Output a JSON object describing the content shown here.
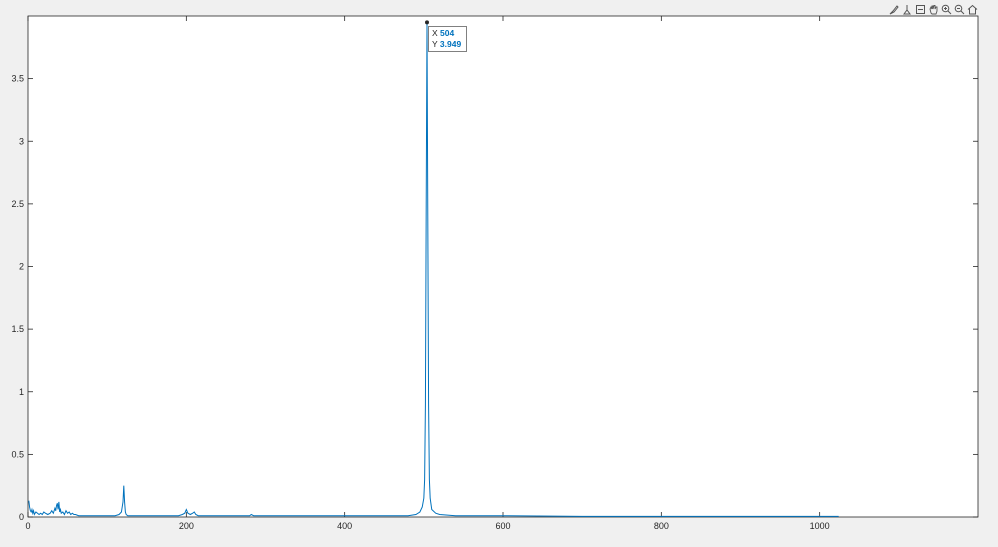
{
  "toolbar": {
    "icons": [
      "brush-icon",
      "datatip-icon",
      "rotate-icon",
      "pan-icon",
      "zoom-in-icon",
      "zoom-out-icon",
      "home-icon"
    ]
  },
  "datatip": {
    "x_label": "X",
    "x_value": "504",
    "y_label": "Y",
    "y_value": "3.949"
  },
  "colors": {
    "line": "#0072bd",
    "axes_bg": "#ffffff",
    "figure_bg": "#f0f0f0",
    "axis": "#262626"
  },
  "chart_data": {
    "type": "line",
    "title": "",
    "xlabel": "",
    "ylabel": "",
    "xlim": [
      0,
      1200
    ],
    "ylim": [
      0,
      4
    ],
    "xticks": [
      0,
      200,
      400,
      600,
      800,
      1000
    ],
    "xtick_labels": [
      "0",
      "200",
      "400",
      "600",
      "800",
      "1000"
    ],
    "yticks": [
      0,
      0.5,
      1,
      1.5,
      2,
      2.5,
      3,
      3.5
    ],
    "ytick_labels": [
      "0",
      "0.5",
      "1",
      "1.5",
      "2",
      "2.5",
      "3",
      "3.5"
    ],
    "grid": false,
    "series": [
      {
        "x": [
          1,
          2,
          3,
          4,
          5,
          6,
          7,
          8,
          10,
          12,
          14,
          16,
          18,
          20,
          22,
          25,
          28,
          30,
          32,
          34,
          35,
          36,
          37,
          38,
          39,
          40,
          41,
          42,
          44,
          46,
          48,
          50,
          52,
          54,
          56,
          58,
          60,
          64,
          70,
          80,
          90,
          100,
          110,
          115,
          118,
          120,
          121,
          122,
          123,
          124,
          126,
          130,
          140,
          150,
          160,
          170,
          180,
          190,
          195,
          198,
          200,
          202,
          205,
          208,
          210,
          212,
          215,
          220,
          240,
          260,
          280,
          282,
          285,
          300,
          350,
          400,
          450,
          480,
          490,
          495,
          498,
          500,
          501,
          502,
          503,
          504,
          505,
          506,
          507,
          508,
          510,
          515,
          520,
          540,
          600,
          700,
          800,
          900,
          1000,
          1024
        ],
        "y": [
          0.13,
          0.08,
          0.05,
          0.04,
          0.06,
          0.03,
          0.05,
          0.02,
          0.04,
          0.03,
          0.02,
          0.03,
          0.02,
          0.04,
          0.03,
          0.02,
          0.03,
          0.05,
          0.03,
          0.07,
          0.05,
          0.09,
          0.11,
          0.06,
          0.12,
          0.04,
          0.06,
          0.03,
          0.04,
          0.02,
          0.05,
          0.03,
          0.04,
          0.02,
          0.03,
          0.02,
          0.02,
          0.01,
          0.01,
          0.01,
          0.01,
          0.01,
          0.01,
          0.02,
          0.04,
          0.12,
          0.25,
          0.12,
          0.04,
          0.02,
          0.01,
          0.01,
          0.01,
          0.01,
          0.01,
          0.01,
          0.01,
          0.01,
          0.02,
          0.03,
          0.06,
          0.03,
          0.02,
          0.03,
          0.04,
          0.02,
          0.01,
          0.01,
          0.01,
          0.01,
          0.01,
          0.02,
          0.01,
          0.01,
          0.01,
          0.01,
          0.01,
          0.01,
          0.02,
          0.04,
          0.08,
          0.15,
          0.3,
          0.9,
          2.5,
          3.949,
          2.4,
          0.9,
          0.3,
          0.15,
          0.06,
          0.03,
          0.02,
          0.01,
          0.01,
          0.005,
          0.005,
          0.005,
          0.005,
          0.005
        ]
      }
    ],
    "datatip_point": {
      "x": 504,
      "y": 3.949
    }
  }
}
